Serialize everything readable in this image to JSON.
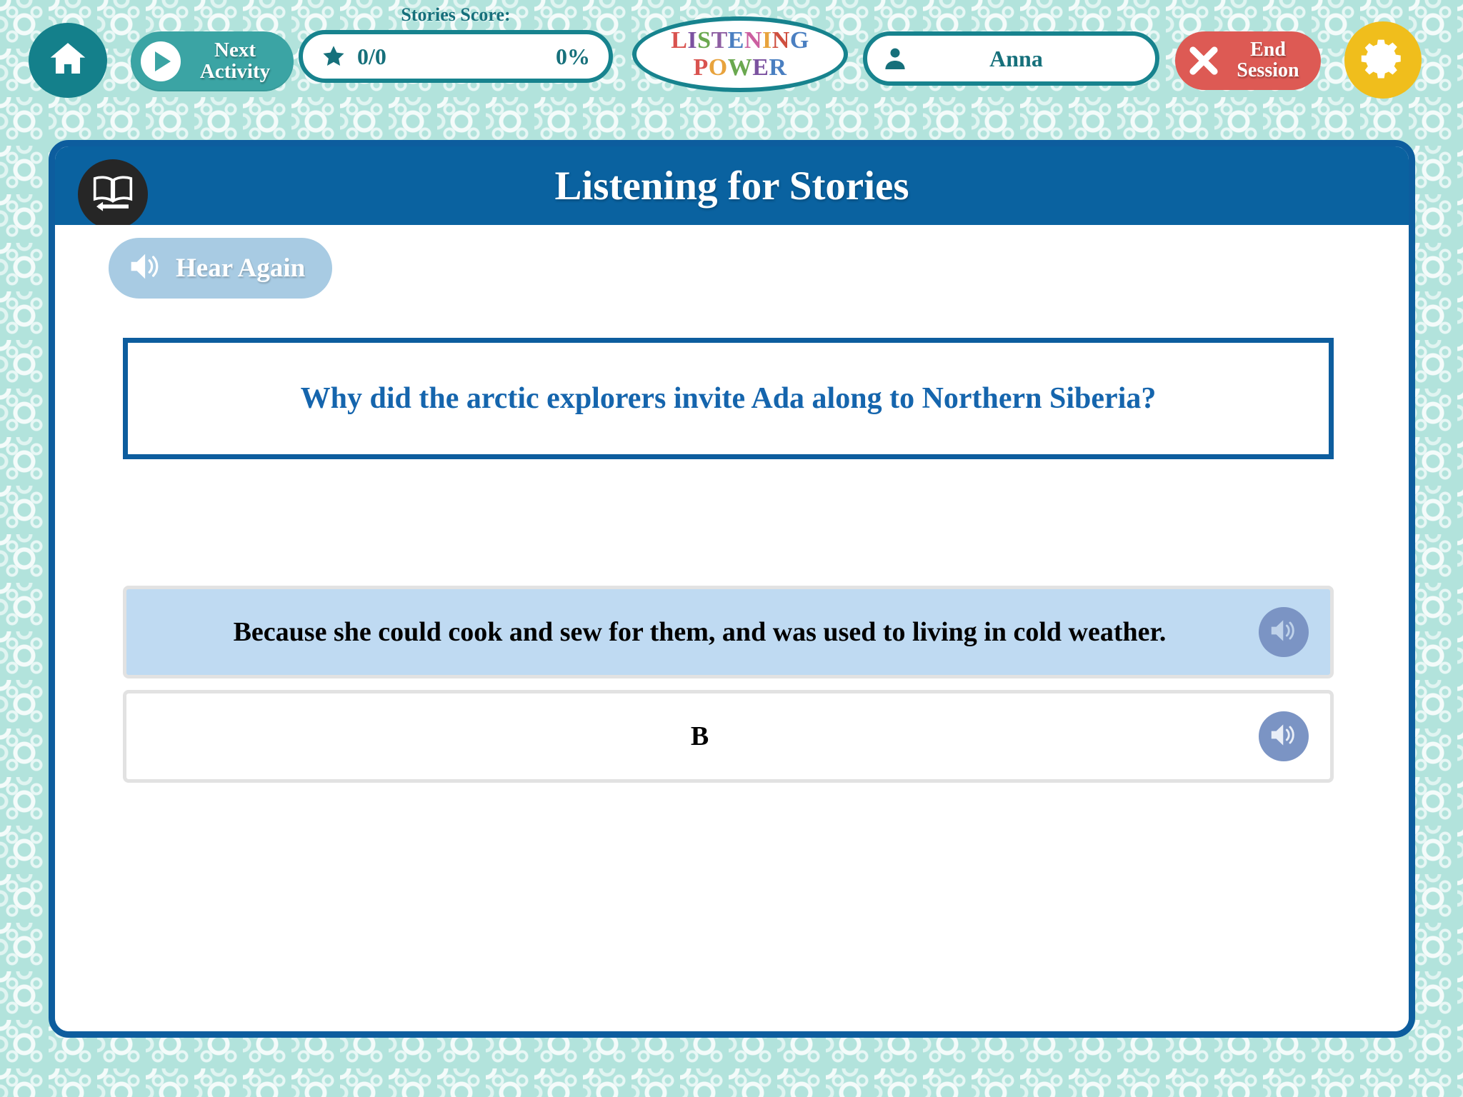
{
  "topbar": {
    "home_icon": "home-icon",
    "next_activity": {
      "line1": "Next",
      "line2": "Activity",
      "icon": "play-icon"
    },
    "score": {
      "caption": "Stories Score:",
      "star_icon": "star-icon",
      "fraction": "0/0",
      "percent": "0%"
    },
    "logo": {
      "line1": "LISTENING",
      "line2": "POWER",
      "line1_letters": [
        "L",
        "I",
        "S",
        "T",
        "E",
        "N",
        "I",
        "N",
        "G"
      ],
      "line1_colors": [
        "#d9534f",
        "#7b52a0",
        "#6aa84f",
        "#8e5ea2",
        "#4a7fc1",
        "#cc5fa0",
        "#e8a33d",
        "#cf4f3f",
        "#4a7fc1"
      ],
      "line2_letters": [
        "P",
        "O",
        "W",
        "E",
        "R"
      ],
      "line2_colors": [
        "#d9534f",
        "#e8a33d",
        "#6aa84f",
        "#7b52a0",
        "#4a7fc1"
      ]
    },
    "user": {
      "icon": "user-icon",
      "name": "Anna"
    },
    "end_session": {
      "line1": "End",
      "line2": "Session",
      "icon": "x-icon"
    },
    "settings_icon": "gear-icon"
  },
  "panel": {
    "back_icon": "book-back-icon",
    "title": "Listening for Stories",
    "hear_again": {
      "label": "Hear Again",
      "icon": "speaker-icon"
    },
    "question": "Why did the arctic explorers invite Ada along to Northern Siberia?",
    "answers": [
      {
        "text": "Because she could cook and sew for them, and was used to living in cold weather.",
        "selected": true,
        "speaker_icon": "speaker-icon"
      },
      {
        "text": "B",
        "selected": false,
        "speaker_icon": "speaker-icon"
      }
    ]
  },
  "colors": {
    "background": "#b2e3dc",
    "teal": "#14808b",
    "panel_blue": "#0a62a0",
    "panel_border": "#0d5d9e",
    "red": "#dd5a54",
    "yellow": "#f0be1c",
    "answer_selected": "#bfdaf2",
    "hear_again": "#a8cbe3",
    "speaker_circle": "#7b94c4"
  }
}
